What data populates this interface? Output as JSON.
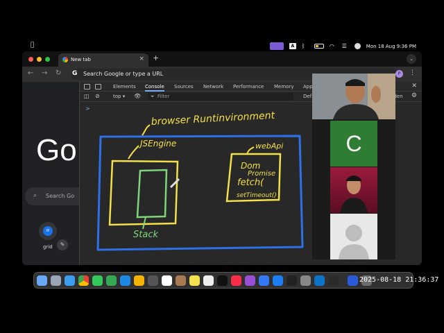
{
  "menubar": {
    "datetime": "Mon 18 Aug  9:36 PM"
  },
  "browser": {
    "tab_title": "New tab",
    "tab_close": "×",
    "new_tab": "+",
    "omnibox_placeholder": "Search Google or type a URL",
    "profile_initial": "P"
  },
  "newtab_page": {
    "logo": "Go",
    "search_label": "Search Go",
    "shortcut_label": "grid",
    "shortcut_badge": "IP"
  },
  "devtools": {
    "tabs": [
      "Elements",
      "Console",
      "Sources",
      "Network",
      "Performance",
      "Memory",
      "App"
    ],
    "active_tab": "Console",
    "context": "top ▾",
    "filter_placeholder": "Filter",
    "default_levels": "Def",
    "hidden": "dden",
    "prompt": ">"
  },
  "drawing": {
    "outer_label": "browser Runtinvironment",
    "engine_label": "JSEngine",
    "stack_label": "Stack",
    "webapi_label": "webApi",
    "webapi_items": [
      "Dom",
      "Promise",
      "fetch(",
      "setTimeout()"
    ],
    "colors": {
      "outer": "#2f6fe8",
      "engine": "#f3e04a",
      "stack": "#7fd67a",
      "webapi": "#f3e04a",
      "label": "#f3e04a"
    }
  },
  "video": {
    "tile_c_initial": "C"
  },
  "dock": {
    "clock": "2025-08-18 21:36:37"
  }
}
